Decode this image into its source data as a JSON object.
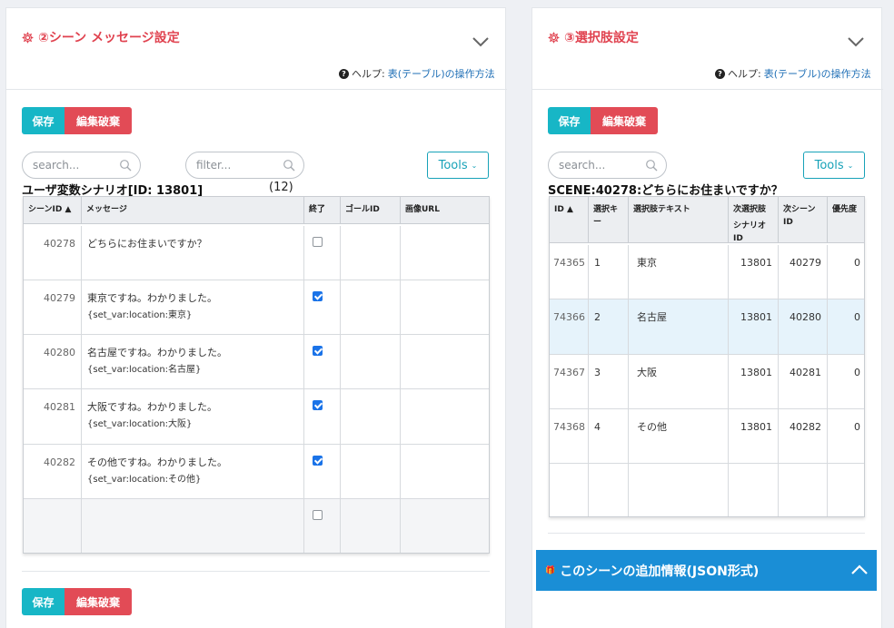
{
  "left_panel": {
    "title": "②シーン メッセージ設定",
    "help_prefix": "ヘルプ:",
    "help_link": "表(テーブル)の操作方法",
    "save_label": "保存",
    "discard_label": "編集破棄",
    "search_placeholder": "search...",
    "filter_placeholder": "filter...",
    "tools_label": "Tools",
    "caption": "ユーザ変数シナリオ[ID: 13801]",
    "count": "(12)",
    "columns": [
      "シーンID ▲",
      "メッセージ",
      "終了",
      "ゴールID",
      "画像URL"
    ],
    "rows": [
      {
        "id": "40278",
        "msg1": "どちらにお住まいですか？",
        "msg2": "",
        "end": false
      },
      {
        "id": "40279",
        "msg1": "東京ですね。わかりました。",
        "msg2": "{set_var:location:東京}",
        "end": true
      },
      {
        "id": "40280",
        "msg1": "名古屋ですね。わかりました。",
        "msg2": "{set_var:location:名古屋}",
        "end": true
      },
      {
        "id": "40281",
        "msg1": "大阪ですね。わかりました。",
        "msg2": "{set_var:location:大阪}",
        "end": true
      },
      {
        "id": "40282",
        "msg1": "その他ですね。わかりました。",
        "msg2": "{set_var:location:その他}",
        "end": true
      },
      {
        "id": "",
        "msg1": "",
        "msg2": "",
        "end": false
      }
    ],
    "bottom_save_label": "保存",
    "bottom_discard_label": "編集破棄"
  },
  "right_panel": {
    "title": "③選択肢設定",
    "help_prefix": "ヘルプ:",
    "help_link": "表(テーブル)の操作方法",
    "save_label": "保存",
    "discard_label": "編集破棄",
    "search_placeholder": "search...",
    "tools_label": "Tools",
    "caption": "SCENE:40278:どちらにお住まいですか？",
    "columns": [
      "ID ▲",
      "選択キー",
      "選択肢テキスト",
      "次選択肢",
      "次シーンID",
      "優先度"
    ],
    "column4_line2": "シナリオID",
    "rows": [
      {
        "id": "74365",
        "key": "1",
        "text": "東京",
        "scenario": "13801",
        "next": "40279",
        "prio": "0"
      },
      {
        "id": "74366",
        "key": "2",
        "text": "名古屋",
        "scenario": "13801",
        "next": "40280",
        "prio": "0"
      },
      {
        "id": "74367",
        "key": "3",
        "text": "大阪",
        "scenario": "13801",
        "next": "40281",
        "prio": "0"
      },
      {
        "id": "74368",
        "key": "4",
        "text": "その他",
        "scenario": "13801",
        "next": "40282",
        "prio": "0"
      },
      {
        "id": "",
        "key": "",
        "text": "",
        "scenario": "",
        "next": "",
        "prio": ""
      }
    ],
    "json_section_title": "このシーンの追加情報(JSON形式)"
  },
  "colors": {
    "accent_red": "#e0424f",
    "save_teal": "#17b6c6",
    "discard_red": "#e24b56",
    "link_blue": "#1f6fb6",
    "json_bar_blue": "#1a8ed6",
    "selected_row": "#e6f3fb"
  }
}
